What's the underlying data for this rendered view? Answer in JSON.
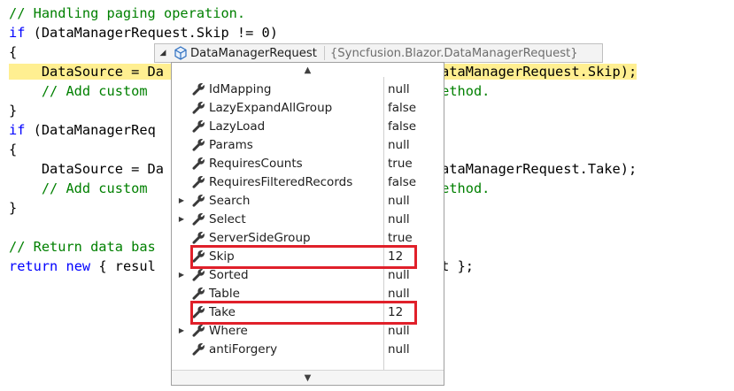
{
  "code_lines": [
    {
      "parts": [
        {
          "c": "cmt",
          "t": "// Handling paging operation."
        }
      ]
    },
    {
      "parts": [
        {
          "c": "kw",
          "t": "if"
        },
        {
          "c": "typ",
          "t": " (DataManagerRequest.Skip != 0)"
        }
      ]
    },
    {
      "parts": [
        {
          "c": "typ",
          "t": "{"
        }
      ]
    },
    {
      "hl": true,
      "parts": [
        {
          "c": "typ",
          "t": "    DataSource = Da"
        },
        {
          "c": "gap",
          "t": "                         "
        },
        {
          "c": "typ",
          "t": "Source, DataManagerRequest.Skip);"
        }
      ]
    },
    {
      "parts": [
        {
          "c": "cmt",
          "t": "    // Add custom "
        },
        {
          "c": "gap",
          "t": "                          "
        },
        {
          "c": "cmt",
          "t": "e above method."
        }
      ]
    },
    {
      "parts": [
        {
          "c": "typ",
          "t": "}"
        }
      ]
    },
    {
      "parts": [
        {
          "c": "kw",
          "t": "if"
        },
        {
          "c": "typ",
          "t": " (DataManagerReq"
        }
      ]
    },
    {
      "parts": [
        {
          "c": "typ",
          "t": "{"
        }
      ]
    },
    {
      "parts": [
        {
          "c": "typ",
          "t": "    DataSource = Da"
        },
        {
          "c": "gap",
          "t": "                         "
        },
        {
          "c": "typ",
          "t": "Source, DataManagerRequest.Take);"
        }
      ]
    },
    {
      "parts": [
        {
          "c": "cmt",
          "t": "    // Add custom "
        },
        {
          "c": "gap",
          "t": "                          "
        },
        {
          "c": "cmt",
          "t": "e above method."
        }
      ]
    },
    {
      "parts": [
        {
          "c": "typ",
          "t": "}"
        }
      ]
    },
    {
      "parts": [
        {
          "c": "typ",
          "t": ""
        }
      ]
    },
    {
      "parts": [
        {
          "c": "cmt",
          "t": "// Return data bas"
        }
      ]
    },
    {
      "parts": [
        {
          "c": "kw",
          "t": "return"
        },
        {
          "c": "typ",
          "t": " "
        },
        {
          "c": "kw",
          "t": "new"
        },
        {
          "c": "typ",
          "t": " { resul"
        },
        {
          "c": "gap",
          "t": "                         "
        },
        {
          "c": "typ",
          "t": "ecordsCount };"
        }
      ]
    }
  ],
  "datatip": {
    "name": "DataManagerRequest",
    "type": "{Syncfusion.Blazor.DataManagerRequest}",
    "icon": "cube-icon"
  },
  "properties": [
    {
      "name": "IdMapping",
      "value": "null",
      "expandable": false
    },
    {
      "name": "LazyExpandAllGroup",
      "value": "false",
      "expandable": false
    },
    {
      "name": "LazyLoad",
      "value": "false",
      "expandable": false
    },
    {
      "name": "Params",
      "value": "null",
      "expandable": false
    },
    {
      "name": "RequiresCounts",
      "value": "true",
      "expandable": false
    },
    {
      "name": "RequiresFilteredRecords",
      "value": "false",
      "expandable": false
    },
    {
      "name": "Search",
      "value": "null",
      "expandable": true
    },
    {
      "name": "Select",
      "value": "null",
      "expandable": true
    },
    {
      "name": "ServerSideGroup",
      "value": "true",
      "expandable": false
    },
    {
      "name": "Skip",
      "value": "12",
      "expandable": false,
      "highlighted": true
    },
    {
      "name": "Sorted",
      "value": "null",
      "expandable": true
    },
    {
      "name": "Table",
      "value": "null",
      "expandable": false
    },
    {
      "name": "Take",
      "value": "12",
      "expandable": false,
      "highlighted": true
    },
    {
      "name": "Where",
      "value": "null",
      "expandable": true
    },
    {
      "name": "antiForgery",
      "value": "null",
      "expandable": false
    }
  ],
  "colors": {
    "highlight_border": "#e0202a",
    "current_line": "#ffef91",
    "keyword": "#0000ff",
    "comment": "#008000"
  }
}
